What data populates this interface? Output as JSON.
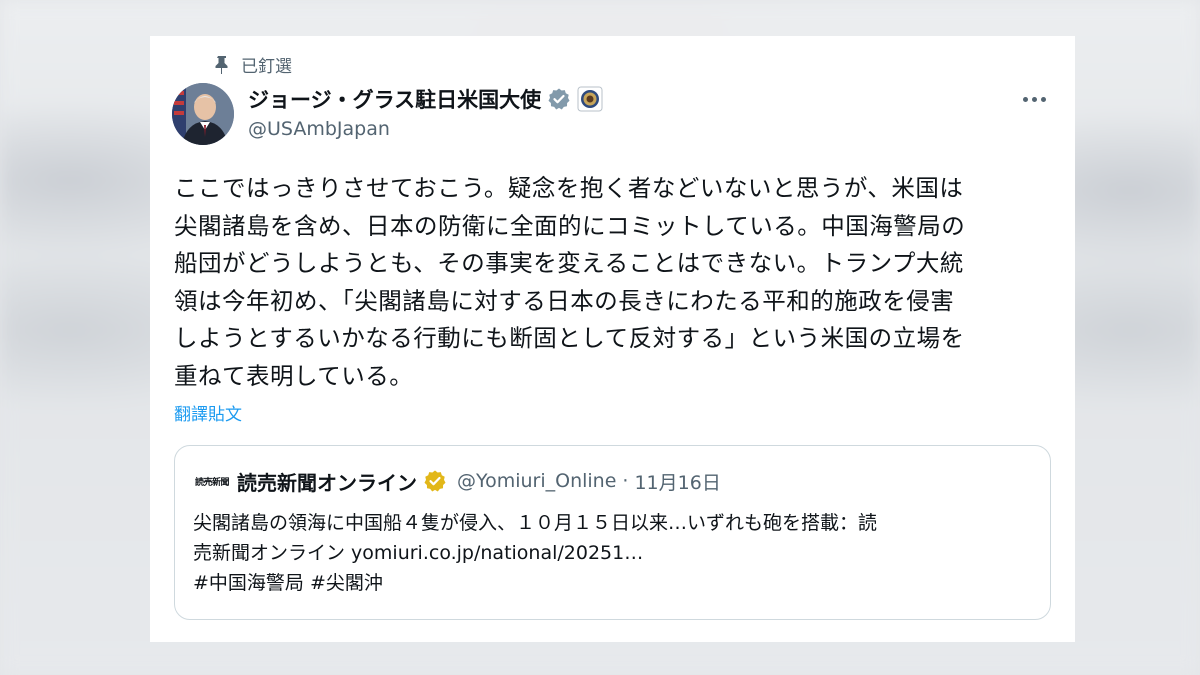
{
  "pinned": {
    "label": "已釘選",
    "icon": "pin-icon"
  },
  "author": {
    "display_name": "ジョージ・グラス駐日米国大使",
    "handle": "@USAmbJapan",
    "verified_color": "#829aab",
    "avatar_icon": "avatar-photo",
    "affiliation_icon": "us-embassy-seal-icon"
  },
  "more_icon": "more-options-icon",
  "tweet": {
    "lines": [
      "ここではっきりさせておこう。疑念を抱く者などいないと思うが、米国は",
      "尖閣諸島を含め、日本の防衛に全面的にコミットしている。中国海警局の",
      "船団がどうしようとも、その事実を変えることはできない。トランプ大統",
      "領は今年初め、「尖閣諸島に対する日本の長きにわたる平和的施政を侵害",
      "しようとするいかなる行動にも断固として反対する」という米国の立場を",
      "重ねて表明している。"
    ],
    "translate_label": "翻譯貼文"
  },
  "quote": {
    "logo_text": "読売新聞",
    "name": "読売新聞オンライン",
    "verified_color": "#e2b719",
    "handle": "@Yomiuri_Online",
    "separator": "·",
    "date": "11月16日",
    "lines": [
      "尖閣諸島の領海に中国船４隻が侵入、１０月１５日以来…いずれも砲を搭載：読",
      "売新聞オンライン yomiuri.co.jp/national/20251…",
      "#中国海警局 #尖閣沖"
    ]
  },
  "colors": {
    "text_primary": "#0f1419",
    "text_secondary": "#536471",
    "link": "#1d9bf0",
    "border": "#cfd9de"
  }
}
